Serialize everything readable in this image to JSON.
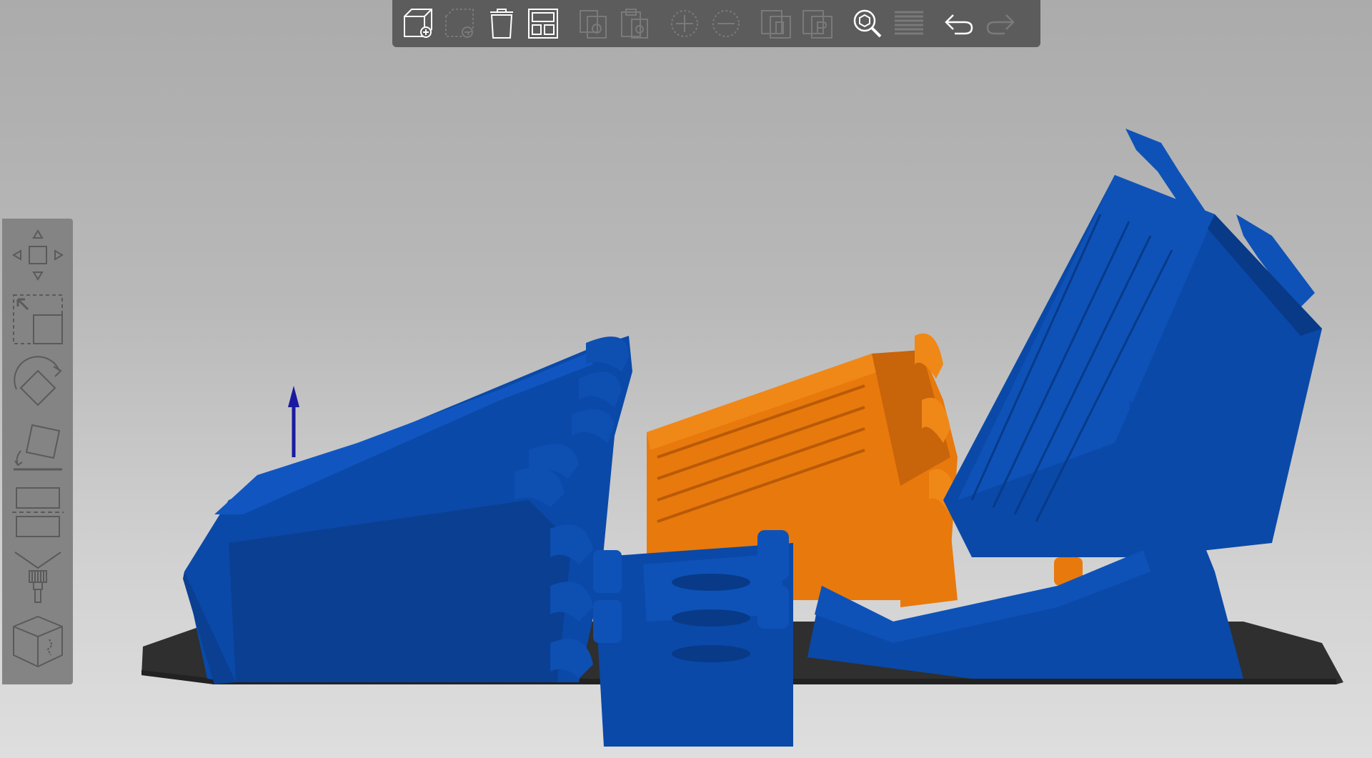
{
  "app": {
    "view": "3d-plater"
  },
  "colors": {
    "background_top": "#ababab",
    "background_bottom": "#dedede",
    "toolbar_bg": "#5c5c5c",
    "left_toolbar_bg": "#848484",
    "model_blue": "#0a49a8",
    "model_blue_dark": "#0a3f92",
    "model_orange": "#e8790c",
    "model_orange_dark": "#c8640a",
    "bed": "#2f2f2f",
    "axis_arrow": "#1a1aa0",
    "icon_enabled": "#ffffff",
    "icon_disabled": "#7a7a7a"
  },
  "top_toolbar": {
    "buttons": [
      {
        "id": "add",
        "icon": "add-cube-icon",
        "enabled": true
      },
      {
        "id": "delete",
        "icon": "delete-selected-icon",
        "enabled": false
      },
      {
        "id": "delete_all",
        "icon": "trash-icon",
        "enabled": true
      },
      {
        "id": "arrange",
        "icon": "arrange-icon",
        "enabled": true
      },
      {
        "id": "copy",
        "icon": "copy-icon",
        "enabled": false
      },
      {
        "id": "paste",
        "icon": "paste-icon",
        "enabled": false
      },
      {
        "id": "add_instance",
        "icon": "plus-circle-icon",
        "enabled": false
      },
      {
        "id": "remove_instance",
        "icon": "minus-circle-icon",
        "enabled": false
      },
      {
        "id": "split_objects",
        "icon": "split-objects-icon",
        "enabled": false
      },
      {
        "id": "split_parts",
        "icon": "split-parts-icon",
        "enabled": false
      },
      {
        "id": "search",
        "icon": "search-icon",
        "enabled": true
      },
      {
        "id": "layers",
        "icon": "layers-icon",
        "enabled": false
      },
      {
        "id": "undo",
        "icon": "undo-icon",
        "enabled": true
      },
      {
        "id": "redo",
        "icon": "redo-icon",
        "enabled": false
      }
    ]
  },
  "left_toolbar": {
    "tools": [
      {
        "id": "move",
        "icon": "move-icon"
      },
      {
        "id": "scale",
        "icon": "scale-icon"
      },
      {
        "id": "rotate",
        "icon": "rotate-icon"
      },
      {
        "id": "place_on_face",
        "icon": "place-on-face-icon"
      },
      {
        "id": "cut",
        "icon": "cut-icon"
      },
      {
        "id": "paint",
        "icon": "paint-brush-icon"
      },
      {
        "id": "seam",
        "icon": "cube-seam-icon"
      }
    ]
  }
}
